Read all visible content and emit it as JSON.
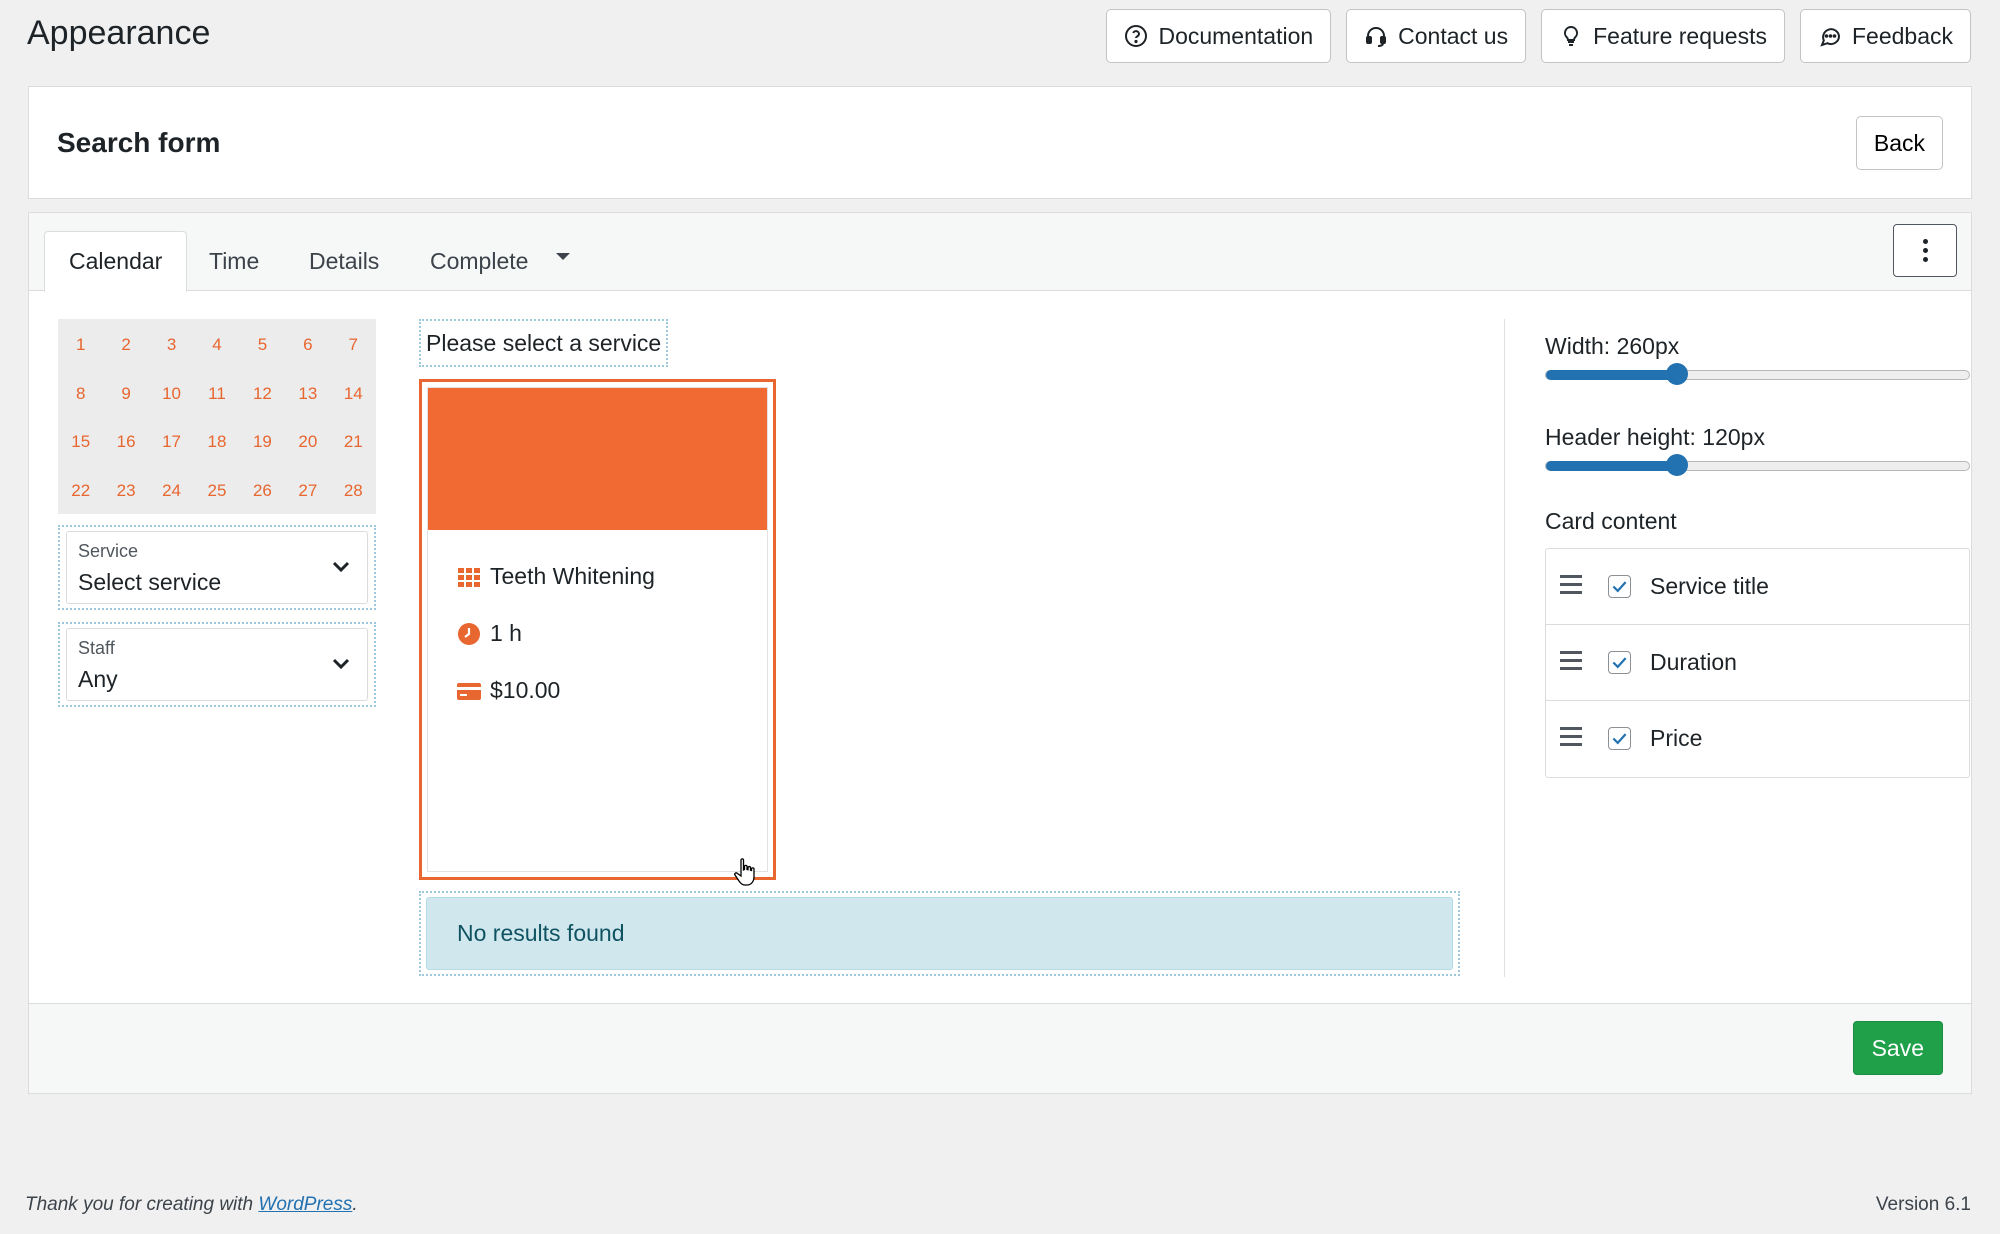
{
  "page": {
    "title": "Appearance"
  },
  "top_actions": [
    {
      "label": "Documentation",
      "icon": "question-circle-icon"
    },
    {
      "label": "Contact us",
      "icon": "headset-icon"
    },
    {
      "label": "Feature requests",
      "icon": "lightbulb-icon"
    },
    {
      "label": "Feedback",
      "icon": "chat-bubble-icon"
    }
  ],
  "form": {
    "title": "Search form",
    "back_label": "Back"
  },
  "tabs": [
    {
      "label": "Calendar",
      "active": true
    },
    {
      "label": "Time"
    },
    {
      "label": "Details"
    },
    {
      "label": "Complete"
    }
  ],
  "calendar": {
    "days": [
      "1",
      "2",
      "3",
      "4",
      "5",
      "6",
      "7",
      "8",
      "9",
      "10",
      "11",
      "12",
      "13",
      "14",
      "15",
      "16",
      "17",
      "18",
      "19",
      "20",
      "21",
      "22",
      "23",
      "24",
      "25",
      "26",
      "27",
      "28"
    ]
  },
  "service_select": {
    "label": "Service",
    "value": "Select service"
  },
  "staff_select": {
    "label": "Staff",
    "value": "Any"
  },
  "preview": {
    "prompt": "Please select a service",
    "card": {
      "title": "Teeth Whitening",
      "duration": "1 h",
      "price": "$10.00"
    },
    "no_results": "No results found"
  },
  "settings": {
    "width_label": "Width: 260px",
    "width_value_fraction": 0.31,
    "header_label": "Header height: 120px",
    "header_value_fraction": 0.31,
    "card_content_label": "Card content",
    "items": [
      {
        "label": "Service title",
        "checked": true
      },
      {
        "label": "Duration",
        "checked": true
      },
      {
        "label": "Price",
        "checked": true
      }
    ]
  },
  "save_label": "Save",
  "footer": {
    "text_prefix": "Thank you for creating with ",
    "link": "WordPress",
    "text_suffix": ".",
    "version": "Version 6.1"
  },
  "colors": {
    "accent": "#f26a33",
    "save": "#1fa049",
    "info_bg": "#d1e7ee",
    "slider": "#2271b1"
  }
}
